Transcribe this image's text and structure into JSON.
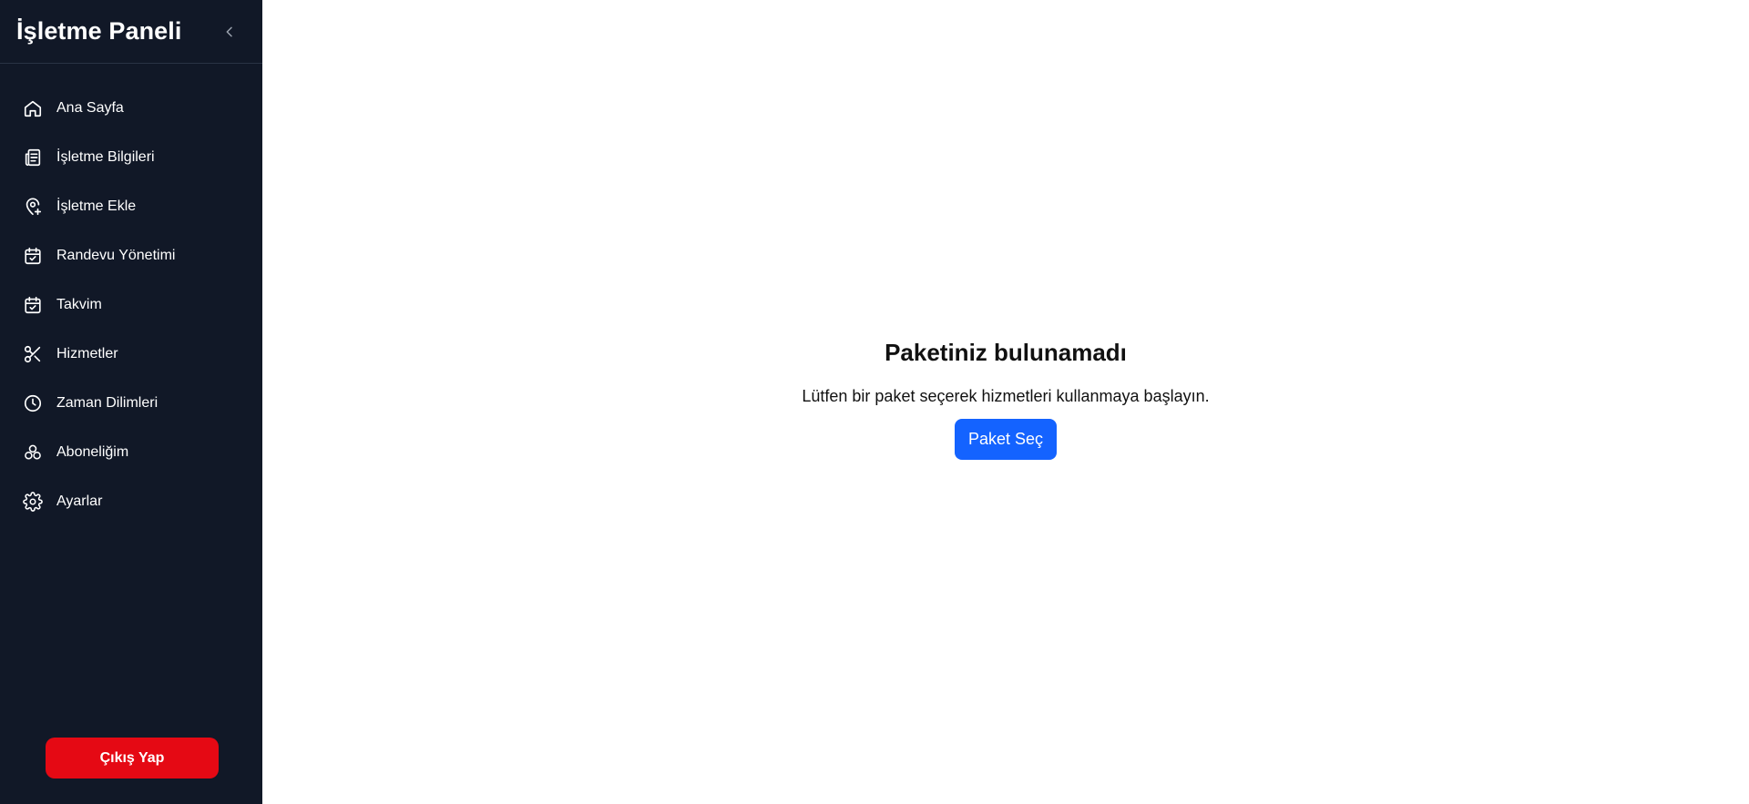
{
  "sidebar": {
    "title": "İşletme Paneli",
    "collapse_icon": "chevron-left-icon",
    "items": [
      {
        "label": "Ana Sayfa",
        "icon": "home-icon"
      },
      {
        "label": "İşletme Bilgileri",
        "icon": "document-icon"
      },
      {
        "label": "İşletme Ekle",
        "icon": "map-pin-plus-icon"
      },
      {
        "label": "Randevu Yönetimi",
        "icon": "calendar-check-icon"
      },
      {
        "label": "Takvim",
        "icon": "calendar-check-icon"
      },
      {
        "label": "Hizmetler",
        "icon": "scissors-icon"
      },
      {
        "label": "Zaman Dilimleri",
        "icon": "clock-icon"
      },
      {
        "label": "Aboneliğim",
        "icon": "boxes-icon"
      },
      {
        "label": "Ayarlar",
        "icon": "gear-icon"
      }
    ],
    "logout_label": "Çıkış Yap"
  },
  "main": {
    "empty_title": "Paketiniz bulunamadı",
    "empty_subtitle": "Lütfen bir paket seçerek hizmetleri kullanmaya başlayın.",
    "select_package_label": "Paket Seç"
  },
  "colors": {
    "sidebar_bg": "#111827",
    "logout_bg": "#e50914",
    "primary": "#1463ff"
  }
}
